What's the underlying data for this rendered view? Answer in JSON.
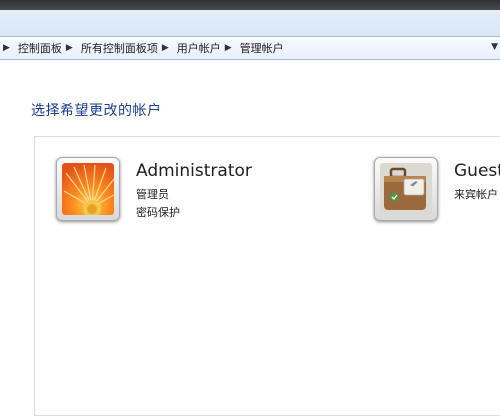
{
  "breadcrumb": {
    "items": [
      {
        "label": "控制面板"
      },
      {
        "label": "所有控制面板项"
      },
      {
        "label": "用户帐户"
      },
      {
        "label": "管理帐户"
      }
    ]
  },
  "main": {
    "heading": "选择希望更改的帐户",
    "accounts": [
      {
        "name": "Administrator",
        "line1": "管理员",
        "line2": "密码保护",
        "icon": "flower-avatar-icon"
      },
      {
        "name": "Guest",
        "line1": "来宾帐户",
        "icon": "suitcase-avatar-icon"
      }
    ]
  },
  "colors": {
    "heading": "#1a3e8f",
    "address_bar": "#d3e3f4"
  }
}
